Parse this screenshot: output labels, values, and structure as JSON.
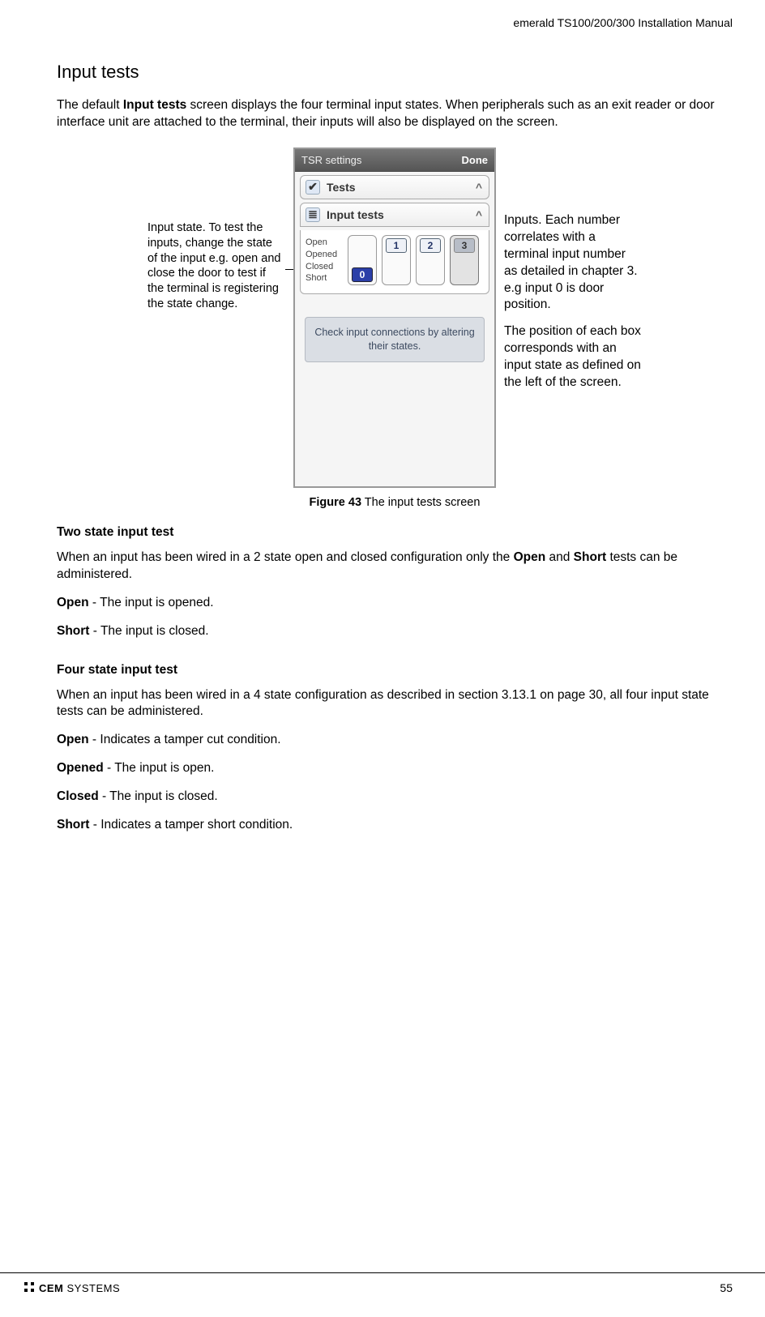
{
  "header": {
    "title": "emerald TS100/200/300 Installation Manual"
  },
  "section": {
    "title": "Input tests",
    "intro_pre": "The default ",
    "intro_bold": "Input tests",
    "intro_post": " screen displays the four terminal input states. When peripherals such as an exit reader or door interface unit are attached to the terminal, their inputs will also be displayed on the screen."
  },
  "callouts": {
    "left": "Input state. To test the inputs, change the state of the input e.g. open and close the door to test if the terminal is registering the state change.",
    "right1": "Inputs. Each number correlates with a terminal input number as detailed in chapter 3. e.g input 0 is door position.",
    "right2": "The position of each box corresponds with an input state as defined on the left of the screen."
  },
  "screenshot": {
    "titlebar": {
      "left": "TSR settings",
      "right": "Done"
    },
    "panel_tests": "Tests",
    "panel_input_tests": "Input tests",
    "chevron": "^",
    "states": [
      "Open",
      "Opened",
      "Closed",
      "Short"
    ],
    "inputs": [
      {
        "num": "0",
        "pos": "short",
        "selected": false
      },
      {
        "num": "1",
        "pos": "open",
        "selected": false
      },
      {
        "num": "2",
        "pos": "open",
        "selected": false
      },
      {
        "num": "3",
        "pos": "opened",
        "selected": true
      }
    ],
    "hint": "Check input connections by altering their states."
  },
  "caption": {
    "bold": "Figure 43",
    "rest": " The input tests screen"
  },
  "two_state": {
    "heading": "Two state input test",
    "p1_pre": "When an input has been wired in a 2 state open and closed configuration only the ",
    "p1_b1": "Open",
    "p1_mid": " and ",
    "p1_b2": "Short",
    "p1_post": " tests can be administered.",
    "open_b": "Open",
    "open_t": " - The input is opened.",
    "short_b": "Short",
    "short_t": " - The input is closed."
  },
  "four_state": {
    "heading": "Four state input test",
    "p1": "When an input has been wired in a 4 state configuration as described in section 3.13.1 on page 30, all four input state tests can be administered.",
    "open_b": "Open",
    "open_t": " - Indicates a tamper cut condition.",
    "opened_b": "Opened",
    "opened_t": " - The input is open.",
    "closed_b": "Closed",
    "closed_t": " - The input is closed.",
    "short_b": "Short",
    "short_t": " - Indicates a tamper short condition."
  },
  "footer": {
    "logo_bold": "CEM",
    "logo_rest": " SYSTEMS",
    "page": "55"
  }
}
